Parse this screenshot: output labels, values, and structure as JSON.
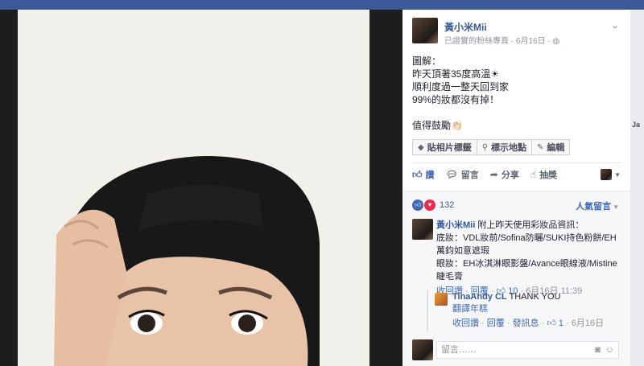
{
  "post": {
    "author": "黃小米Mii",
    "meta": "已證實的粉絲專頁 · 6月16日 · ",
    "meta_icon": "globe-icon",
    "lines": [
      "圖解：",
      "昨天頂著35度高溫☀︎",
      "順利度過一整天回到家",
      "99%的妝都沒有掉！",
      "",
      "值得鼓勵👏🏻"
    ],
    "tag_buttons": [
      {
        "icon": "tag-icon",
        "label": "貼相片標籤"
      },
      {
        "icon": "location-pin-icon",
        "label": "標示地點"
      },
      {
        "icon": "pencil-icon",
        "label": "編輯"
      }
    ],
    "actions": {
      "like": "讚",
      "comment": "留言",
      "share": "分享",
      "prize": "抽獎"
    }
  },
  "comments_panel": {
    "reaction_count": "132",
    "sort_label": "人氣留言",
    "comment": {
      "author": "黃小米Mii",
      "intro": " 附上昨天使用彩妝品資訊：",
      "lines": [
        "底妝：VDL妝前/Sofina防曬/SUKI持色粉餅/EH萬鈞如意遮瑕",
        "眼妝：EH冰淇淋眼影盤/Avance眼線液/Mistine睫毛膏"
      ],
      "unlike": "收回讚",
      "reply": "回覆",
      "likes": "10",
      "date": "6月16日 11:39"
    },
    "reply": {
      "author": "TinaAndy CL",
      "text": " THANK YOU",
      "translate": "翻譯年糕",
      "unlike": "收回讚",
      "reply": "回覆",
      "dm": "發訊息",
      "likes": "1",
      "date": "6月16日"
    },
    "input_placeholder": "留言……"
  },
  "side": {
    "edge_text": "Ja"
  }
}
